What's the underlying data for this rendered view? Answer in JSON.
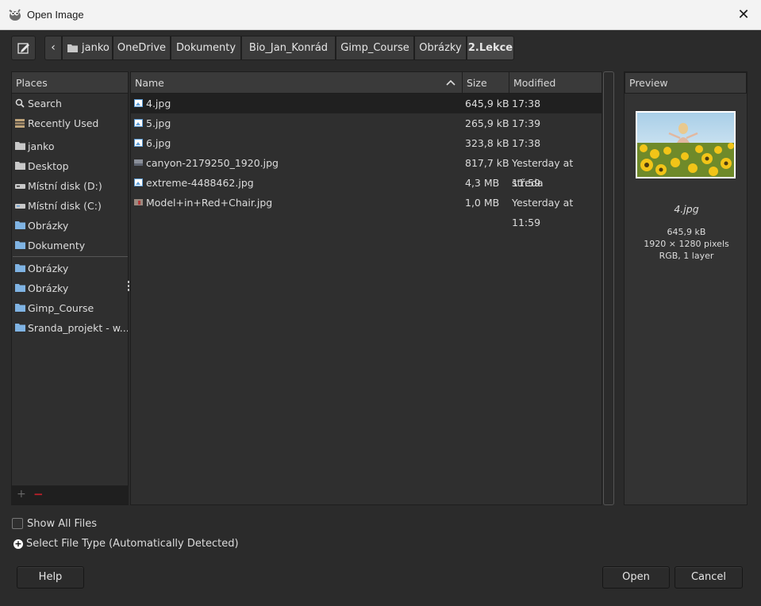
{
  "window": {
    "title": "Open Image",
    "close_glyph": "✕"
  },
  "pathbar": {
    "back_glyph": "‹",
    "crumbs": [
      "janko",
      "OneDrive",
      "Dokumenty",
      "Bio_Jan_Konrád",
      "Gimp_Course",
      "Obrázky",
      "2.Lekce"
    ],
    "active_index": 6
  },
  "places": {
    "header": "Places",
    "items": [
      {
        "label": "Search",
        "icon": "search-icon"
      },
      {
        "label": "Recently Used",
        "icon": "recent-icon"
      },
      {
        "label": "janko",
        "icon": "folder-icon"
      },
      {
        "label": "Desktop",
        "icon": "folder-icon"
      },
      {
        "label": "Místní disk (D:)",
        "icon": "drive-icon"
      },
      {
        "label": "Místní disk (C:)",
        "icon": "drive-icon"
      },
      {
        "label": "Obrázky",
        "icon": "folder-blue-icon"
      },
      {
        "label": "Dokumenty",
        "icon": "folder-blue-icon"
      },
      {
        "label": "Obrázky",
        "icon": "folder-blue-icon"
      },
      {
        "label": "Obrázky",
        "icon": "folder-blue-icon"
      },
      {
        "label": "Gimp_Course",
        "icon": "folder-blue-icon"
      },
      {
        "label": "Sranda_projekt - w...",
        "icon": "folder-blue-icon"
      }
    ],
    "add_glyph": "+",
    "remove_glyph": "−"
  },
  "files": {
    "columns": {
      "name": "Name",
      "size": "Size",
      "modified": "Modified"
    },
    "sort_glyph": "^",
    "rows": [
      {
        "name": "4.jpg",
        "size": "645,9 kB",
        "modified": "17:38",
        "selected": true
      },
      {
        "name": "5.jpg",
        "size": "265,9 kB",
        "modified": "17:39"
      },
      {
        "name": "6.jpg",
        "size": "323,8 kB",
        "modified": "17:38"
      },
      {
        "name": "canyon-2179250_1920.jpg",
        "size": "817,7 kB",
        "modified": "Yesterday at 11:59"
      },
      {
        "name": "extreme-4488462.jpg",
        "size": "4,3 MB",
        "modified": "středa"
      },
      {
        "name": "Model+in+Red+Chair.jpg",
        "size": "1,0 MB",
        "modified": "Yesterday at 11:59"
      }
    ]
  },
  "preview": {
    "header": "Preview",
    "filename": "4.jpg",
    "size": "645,9 kB",
    "dimensions": "1920 × 1280 pixels",
    "mode": "RGB, 1 layer"
  },
  "options": {
    "show_all_files": "Show All Files",
    "expander_glyph": "+",
    "select_file_type": "Select File Type (Automatically Detected)"
  },
  "buttons": {
    "help": "Help",
    "open": "Open",
    "cancel": "Cancel"
  },
  "colors": {
    "accent_blue": "#5b9bd5",
    "folder_gray": "#c8c8c8"
  }
}
